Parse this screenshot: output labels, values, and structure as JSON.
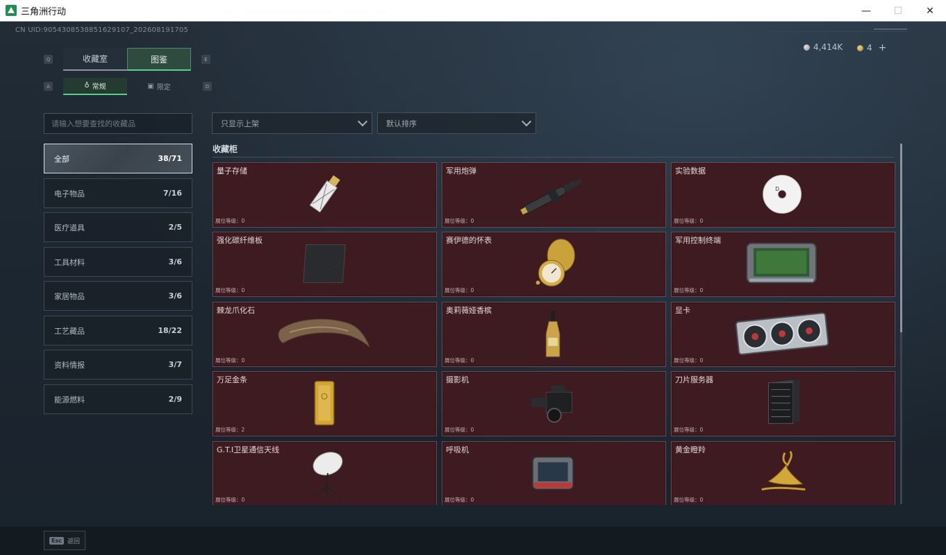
{
  "window": {
    "title": "三角洲行动",
    "minimize": "—",
    "maximize": "☐",
    "close": "✕"
  },
  "uid": "CN UID:9054308538851629107_202608191705",
  "currency": {
    "coin_a": "4,414K",
    "coin_b": "4",
    "add": "+"
  },
  "tabs": {
    "key_left": "Q",
    "key_right": "E",
    "items": [
      {
        "label": "收藏室"
      },
      {
        "label": "图鉴"
      }
    ],
    "active": 1
  },
  "subtabs": {
    "key_left": "A",
    "key_right": "D",
    "items": [
      {
        "label": "常规",
        "icon": "♁"
      },
      {
        "label": "限定",
        "icon": "▣"
      }
    ],
    "active": 0
  },
  "search": {
    "placeholder": "请输入想要查找的收藏品"
  },
  "categories": [
    {
      "label": "全部",
      "count": "38/71"
    },
    {
      "label": "电子物品",
      "count": "7/16"
    },
    {
      "label": "医疗道具",
      "count": "2/5"
    },
    {
      "label": "工具材料",
      "count": "3/6"
    },
    {
      "label": "家居物品",
      "count": "3/6"
    },
    {
      "label": "工艺藏品",
      "count": "18/22"
    },
    {
      "label": "资料情报",
      "count": "3/7"
    },
    {
      "label": "能源燃料",
      "count": "2/9"
    }
  ],
  "filters": {
    "display": "只显示上架",
    "sort": "默认排序"
  },
  "section_title": "收藏柜",
  "items": [
    {
      "name": "量子存储",
      "level": "展位等级：0",
      "icon": "usb-drive-icon"
    },
    {
      "name": "军用炮弹",
      "level": "展位等级：0",
      "icon": "artillery-shell-icon"
    },
    {
      "name": "实验数据",
      "level": "展位等级：0",
      "icon": "disc-icon"
    },
    {
      "name": "强化碳纤维板",
      "level": "展位等级：0",
      "icon": "carbon-plate-icon"
    },
    {
      "name": "赛伊德的怀表",
      "level": "展位等级：0",
      "icon": "pocket-watch-icon"
    },
    {
      "name": "军用控制终端",
      "level": "展位等级：0",
      "icon": "control-terminal-icon"
    },
    {
      "name": "棘龙爪化石",
      "level": "展位等级：0",
      "icon": "claw-fossil-icon"
    },
    {
      "name": "奥莉薇娅香槟",
      "level": "展位等级：0",
      "icon": "champagne-bottle-icon"
    },
    {
      "name": "显卡",
      "level": "展位等级：0",
      "icon": "graphics-card-icon"
    },
    {
      "name": "万足金条",
      "level": "展位等级：2",
      "icon": "gold-bar-icon"
    },
    {
      "name": "摄影机",
      "level": "展位等级：0",
      "icon": "camera-icon"
    },
    {
      "name": "刀片服务器",
      "level": "展位等级：0",
      "icon": "server-icon"
    },
    {
      "name": "G.T.I卫星通信天线",
      "level": "展位等级：0",
      "icon": "satellite-dish-icon"
    },
    {
      "name": "呼吸机",
      "level": "展位等级：0",
      "icon": "ventilator-icon"
    },
    {
      "name": "黄金瞪羚",
      "level": "展位等级：0",
      "icon": "golden-gazelle-icon"
    }
  ],
  "footer": {
    "esc_key": "Esc",
    "back_label": "返回"
  }
}
